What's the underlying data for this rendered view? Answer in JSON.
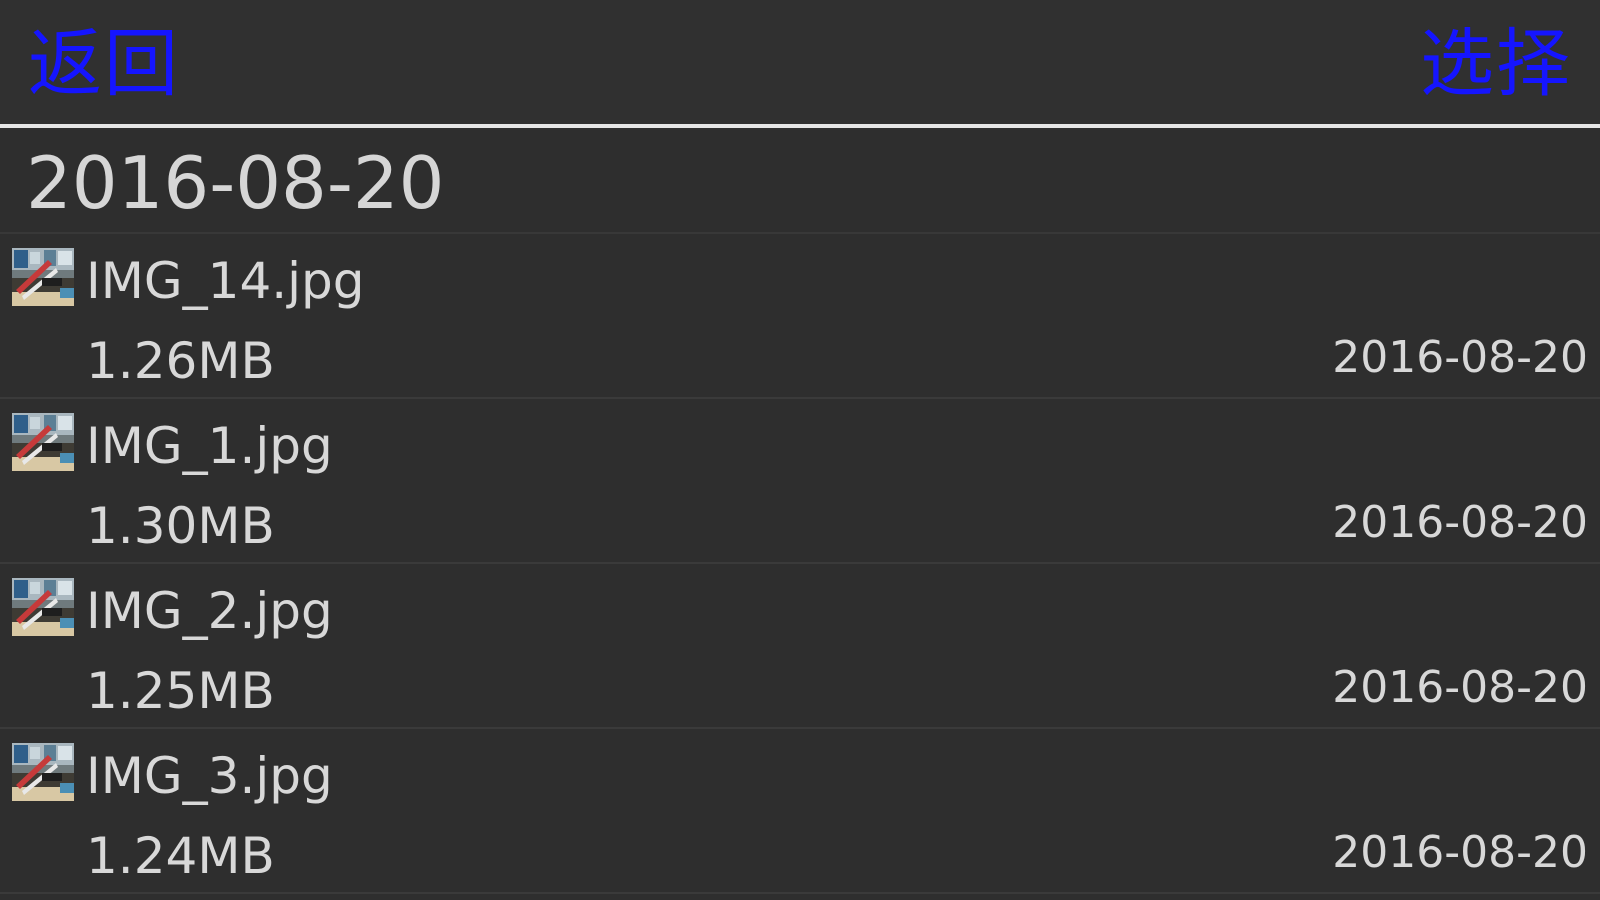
{
  "topbar": {
    "back_label": "返回",
    "select_label": "选择",
    "accent_color": "#1515ff"
  },
  "group": {
    "date": "2016-08-20"
  },
  "files": [
    {
      "name": "IMG_14.jpg",
      "size": "1.26MB",
      "date": "2016-08-20",
      "icon": "image-thumbnail-icon"
    },
    {
      "name": "IMG_1.jpg",
      "size": "1.30MB",
      "date": "2016-08-20",
      "icon": "image-thumbnail-icon"
    },
    {
      "name": "IMG_2.jpg",
      "size": "1.25MB",
      "date": "2016-08-20",
      "icon": "image-thumbnail-icon"
    },
    {
      "name": "IMG_3.jpg",
      "size": "1.24MB",
      "date": "2016-08-20",
      "icon": "image-thumbnail-icon"
    }
  ]
}
